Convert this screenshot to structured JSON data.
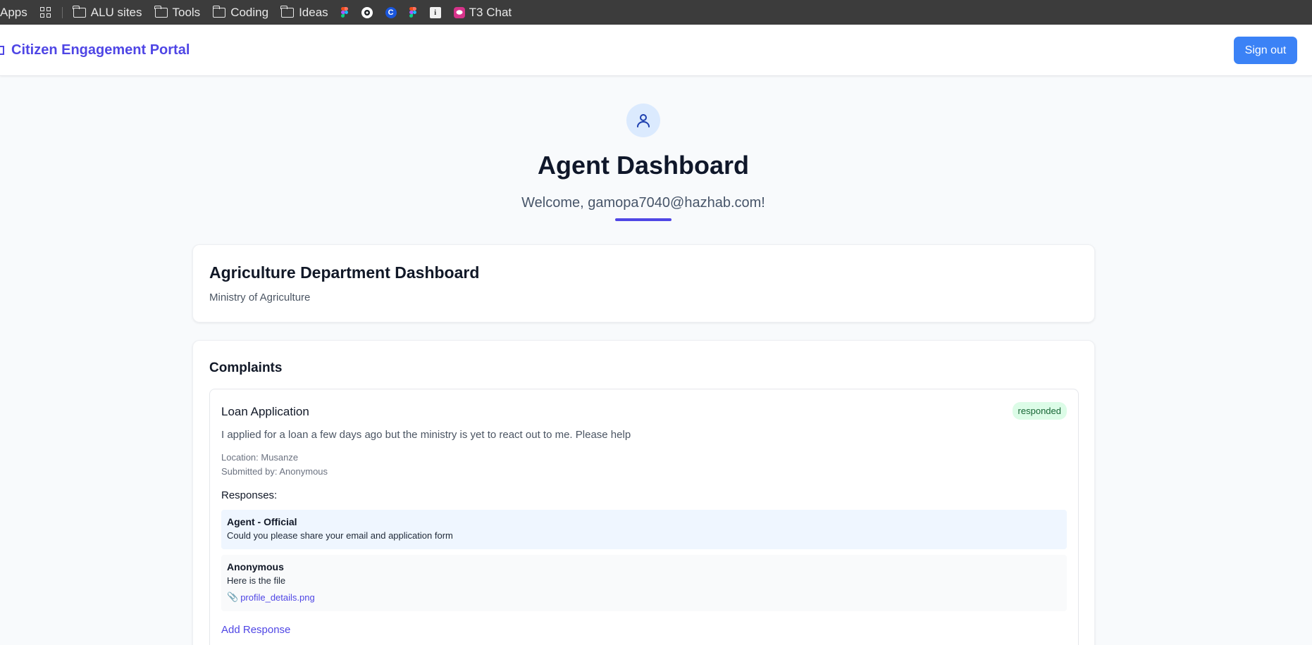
{
  "bookmarks": {
    "apps_label": "Apps",
    "folders": [
      "ALU sites",
      "Tools",
      "Coding",
      "Ideas"
    ],
    "t3_label": "T3 Chat"
  },
  "header": {
    "brand": "Citizen Engagement Portal",
    "sign_out": "Sign out",
    "accent_color": "#4f46e5",
    "button_color": "#3b82f6"
  },
  "hero": {
    "title": "Agent Dashboard",
    "welcome": "Welcome, gamopa7040@hazhab.com!",
    "icon": "user-icon"
  },
  "department": {
    "title": "Agriculture Department Dashboard",
    "ministry": "Ministry of Agriculture"
  },
  "complaints": {
    "heading": "Complaints",
    "items": [
      {
        "title": "Loan Application",
        "status": "responded",
        "description": "I applied for a loan a few days ago but the ministry is yet to react out to me. Please help",
        "location": "Location: Musanze",
        "submitted_by": "Submitted by: Anonymous",
        "responses_heading": "Responses:",
        "responses": [
          {
            "author": "Agent - Official",
            "text": "Could you please share your email and application form"
          },
          {
            "author": "Anonymous",
            "text": "Here is the file",
            "attachment": "profile_details.png"
          }
        ],
        "add_response": "Add Response"
      }
    ]
  }
}
